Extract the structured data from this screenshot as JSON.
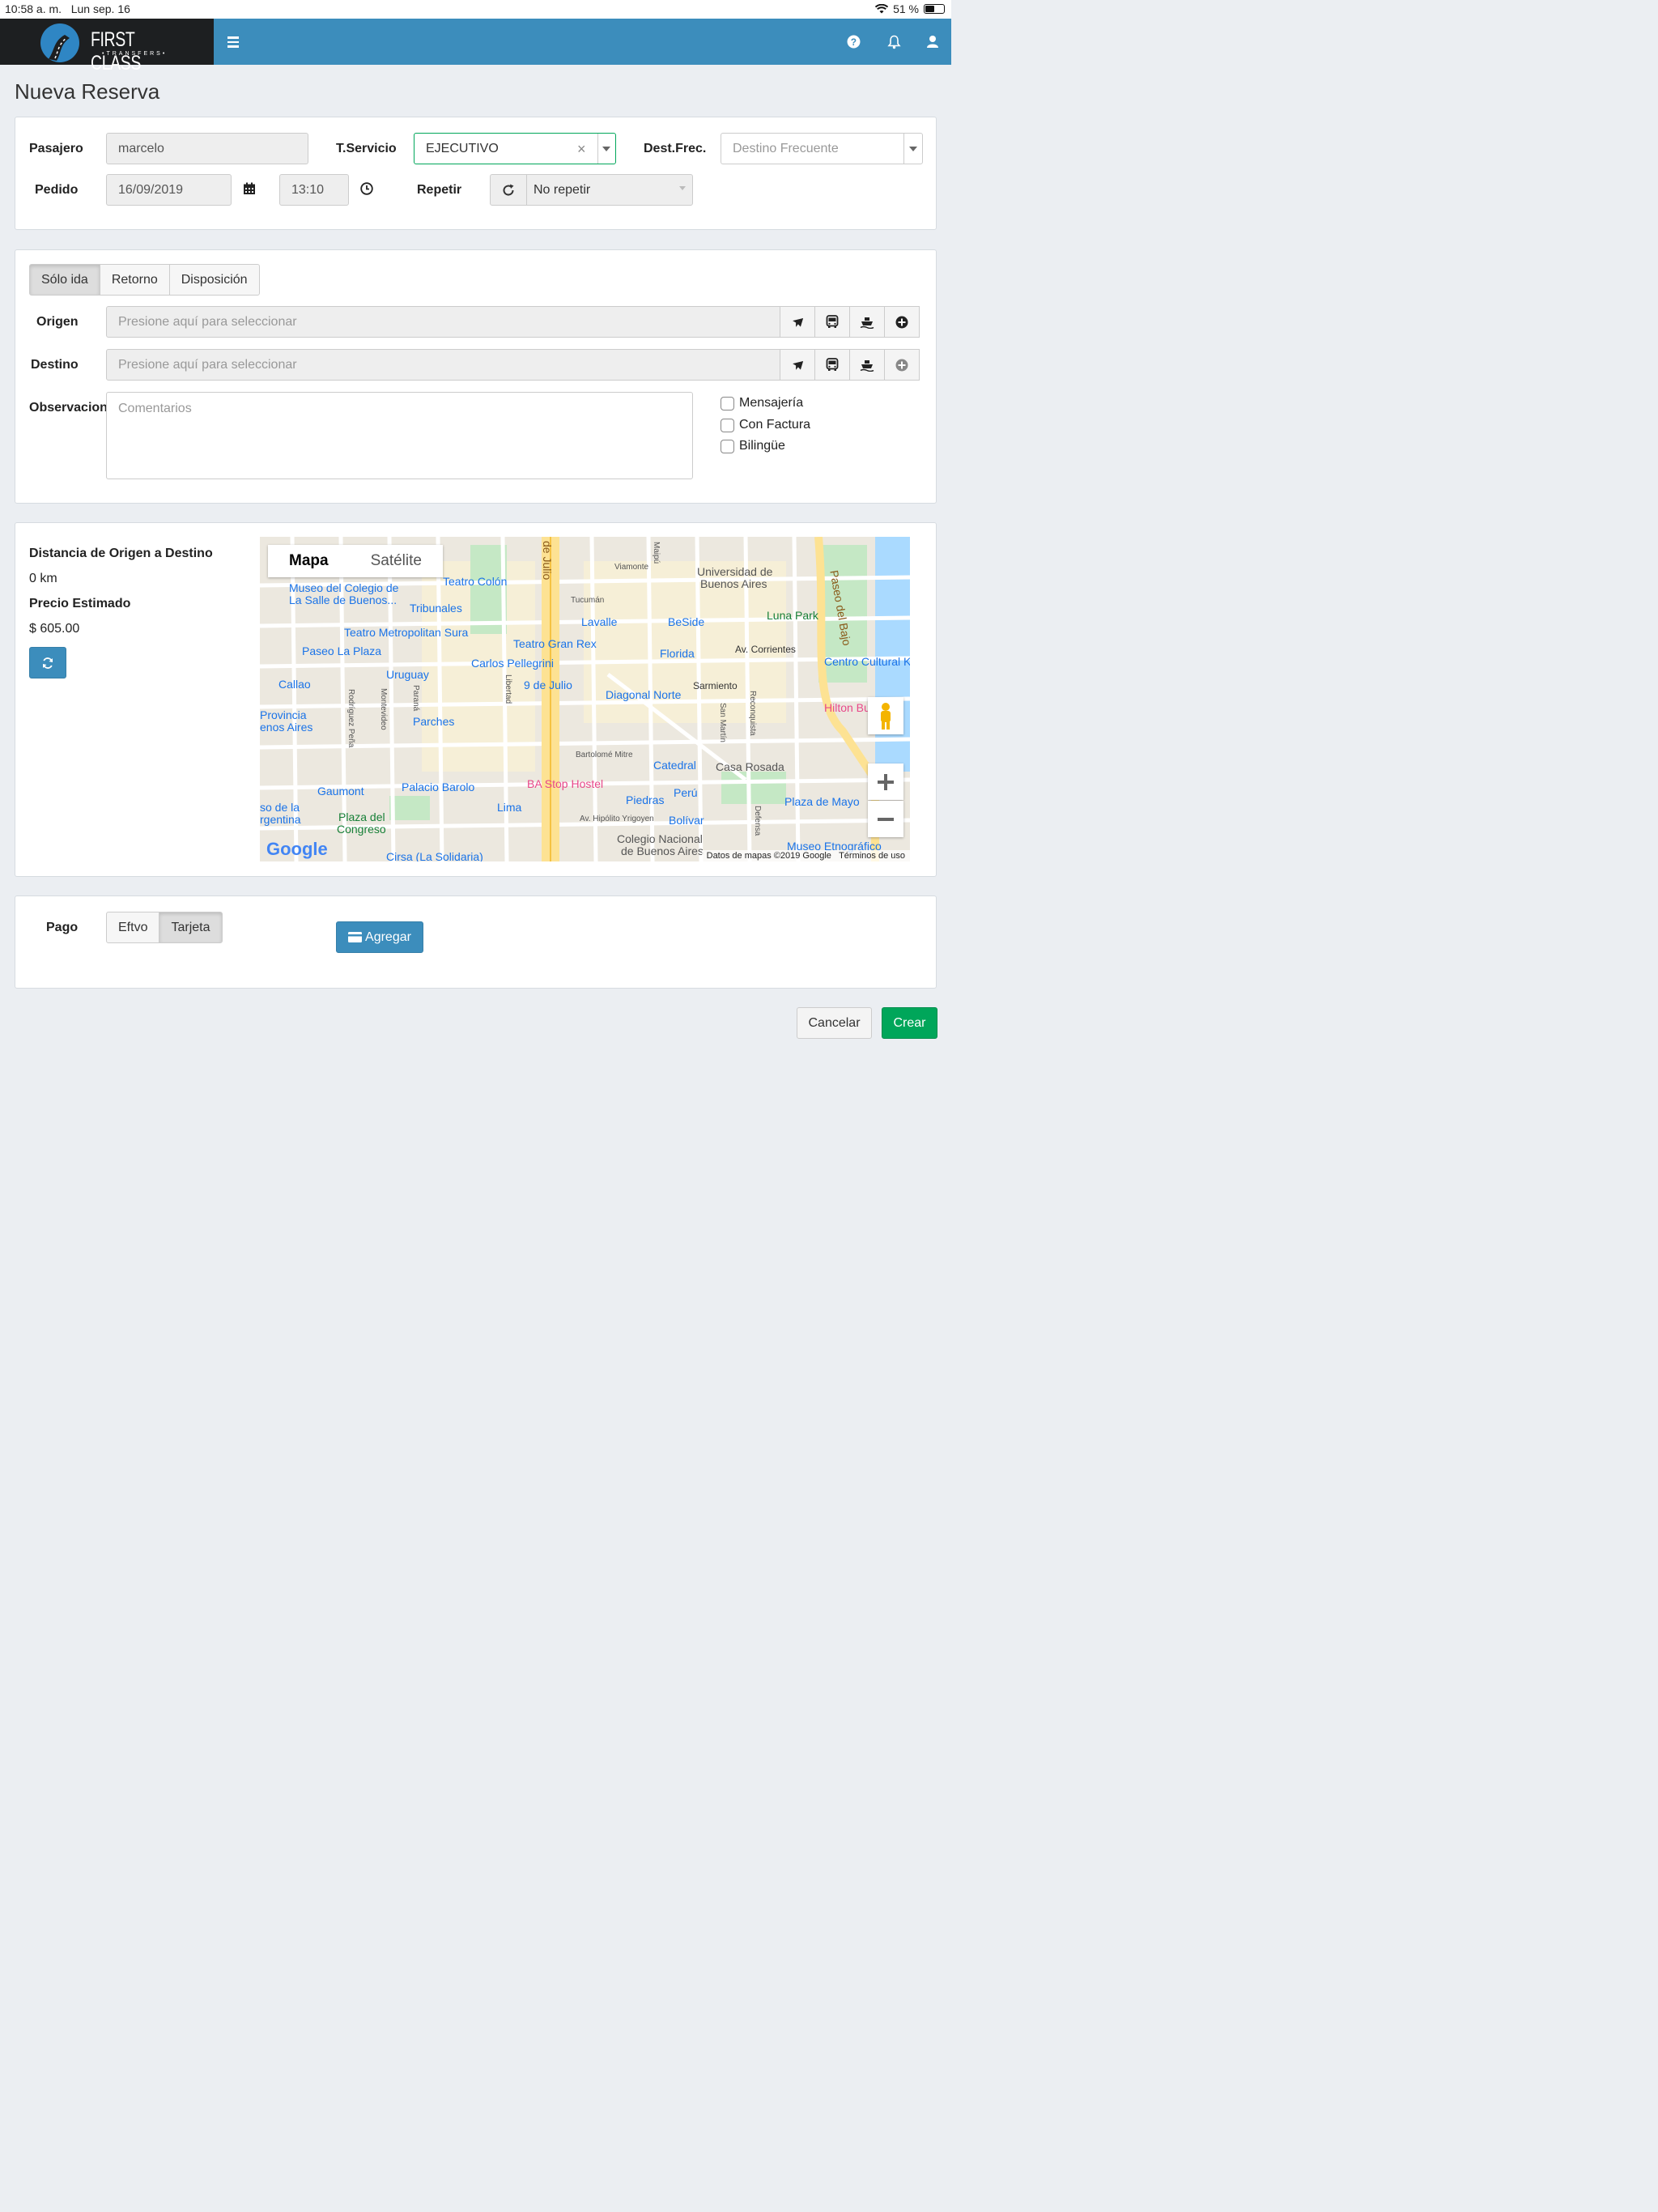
{
  "status_bar": {
    "time": "10:58 a. m.",
    "date": "Lun sep. 16",
    "battery": "51 %"
  },
  "brand": {
    "name": "FIRST CLASS",
    "tagline": "•TRANSFERS•"
  },
  "page": {
    "title": "Nueva Reserva"
  },
  "reservation": {
    "pasajero_label": "Pasajero",
    "pasajero_value": "marcelo",
    "servicio_label": "T.Servicio",
    "servicio_value": "EJECUTIVO",
    "clear_glyph": "×",
    "dest_frec_label": "Dest.Frec.",
    "dest_frec_placeholder": "Destino Frecuente",
    "pedido_label": "Pedido",
    "date_value": "16/09/2019",
    "time_value": "13:10",
    "repetir_label": "Repetir",
    "repetir_value": "No repetir"
  },
  "trip": {
    "tabs": [
      "Sólo ida",
      "Retorno",
      "Disposición"
    ],
    "active_tab": 0,
    "origen_label": "Origen",
    "destino_label": "Destino",
    "select_placeholder": "Presione aquí para seleccionar",
    "observ_label": "Observacion",
    "observ_placeholder": "Comentarios",
    "options": [
      "Mensajería",
      "Con Factura",
      "Bilingüe"
    ],
    "icons": [
      "plane-icon",
      "bus-icon",
      "ship-icon",
      "plus-circle-icon"
    ]
  },
  "estimate": {
    "distance_label": "Distancia de Origen a Destino",
    "distance_value": "0 km",
    "price_label": "Precio Estimado",
    "price_value": "$ 605.00"
  },
  "map": {
    "tab_map": "Mapa",
    "tab_sat": "Satélite",
    "logo": "Google",
    "attribution": "Datos de mapas ©2019 Google",
    "terms": "Términos de uso",
    "labels": [
      "Museo del Colegio de",
      "La Salle de Buenos...",
      "Teatro Colón",
      "Tribunales",
      "Teatro Metropolitan Sura",
      "Paseo La Plaza",
      "Uruguay",
      "Callao",
      "Carlos Pellegrini",
      "9 de Julio",
      "Diagonal Norte",
      "Teatro Gran Rex",
      "Lavalle",
      "BeSide",
      "Florida",
      "Universidad de",
      "Buenos Aires",
      "Luna Park",
      "Centro Cultural K",
      "Av. Corrientes",
      "Sarmiento",
      "Parches",
      "Provincia",
      "enos Aires",
      "Catedral",
      "Casa Rosada",
      "Gaumont",
      "Palacio Barolo",
      "BA Stop Hostel",
      "Plaza del",
      "Congreso",
      "Lima",
      "Piedras",
      "Perú",
      "Plaza de Mayo",
      "Bolívar",
      "Colegio Nacional",
      "de Buenos Aires",
      "Museo Etnográfico",
      "Cirsa (La Solidaria)",
      "Hilton Bu",
      "Paseo del Bajo",
      "de Julio",
      "Tucumán",
      "Viamonte",
      "Maipú",
      "Libertad",
      "Rodríguez Peña",
      "Montevideo",
      "Paraná",
      "Bartolomé Mitre",
      "San Martín",
      "Reconquista",
      "Defensa",
      "Av. Hipólito Yrigoyen",
      "so de la",
      "rgentina"
    ]
  },
  "payment": {
    "label": "Pago",
    "options": [
      "Eftvo",
      "Tarjeta"
    ],
    "active": 1,
    "add_label": "Agregar"
  },
  "actions": {
    "cancel": "Cancelar",
    "create": "Crear"
  },
  "colors": {
    "header": "#3c8dbc",
    "primary": "#3c8dbc",
    "success": "#00a65a",
    "logo_bg": "#1d1f21"
  }
}
